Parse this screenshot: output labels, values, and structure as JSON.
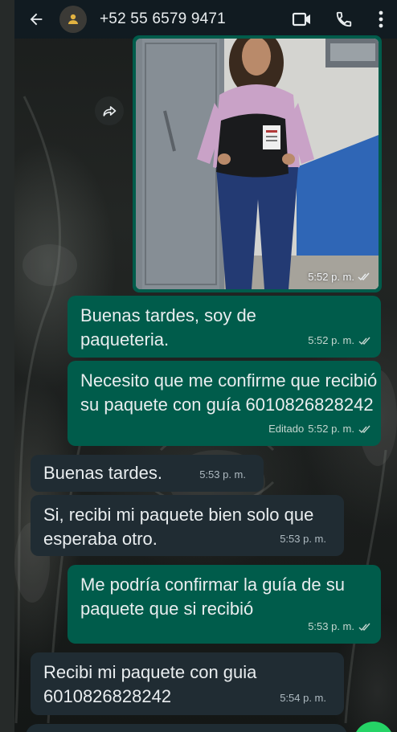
{
  "header": {
    "contact": "+52 55 6579 9471",
    "back_icon": "arrow-left-icon",
    "video_icon": "video-camera-icon",
    "call_icon": "phone-icon",
    "menu_icon": "more-vertical-icon"
  },
  "messages": [
    {
      "type": "image",
      "direction": "out",
      "time": "5:52 p. m.",
      "status": "read"
    },
    {
      "type": "text",
      "direction": "out",
      "text": "Buenas tardes, soy de paqueteria.",
      "time": "5:52 p. m.",
      "status": "read"
    },
    {
      "type": "text",
      "direction": "out",
      "text": "Necesito que me confirme que recibió su paquete con guía 6010826828242",
      "edited_label": "Editado",
      "time": "5:52 p. m.",
      "status": "read"
    },
    {
      "type": "text",
      "direction": "in",
      "text": "Buenas tardes.",
      "time": "5:53 p. m."
    },
    {
      "type": "text",
      "direction": "in",
      "text": "Si, recibi mi paquete bien solo que esperaba otro.",
      "time": "5:53 p. m."
    },
    {
      "type": "text",
      "direction": "out",
      "text": "Me podría confirmar la guía de su paquete que si recibió",
      "time": "5:53 p. m.",
      "status": "read"
    },
    {
      "type": "text",
      "direction": "in",
      "text": "Recibi mi paquete con guia 6010826828242",
      "time": "5:54 p. m."
    }
  ],
  "colors": {
    "header_bg": "#111b21",
    "outgoing_bubble": "#005c4b",
    "incoming_bubble": "#202c33",
    "fab": "#25d366"
  }
}
